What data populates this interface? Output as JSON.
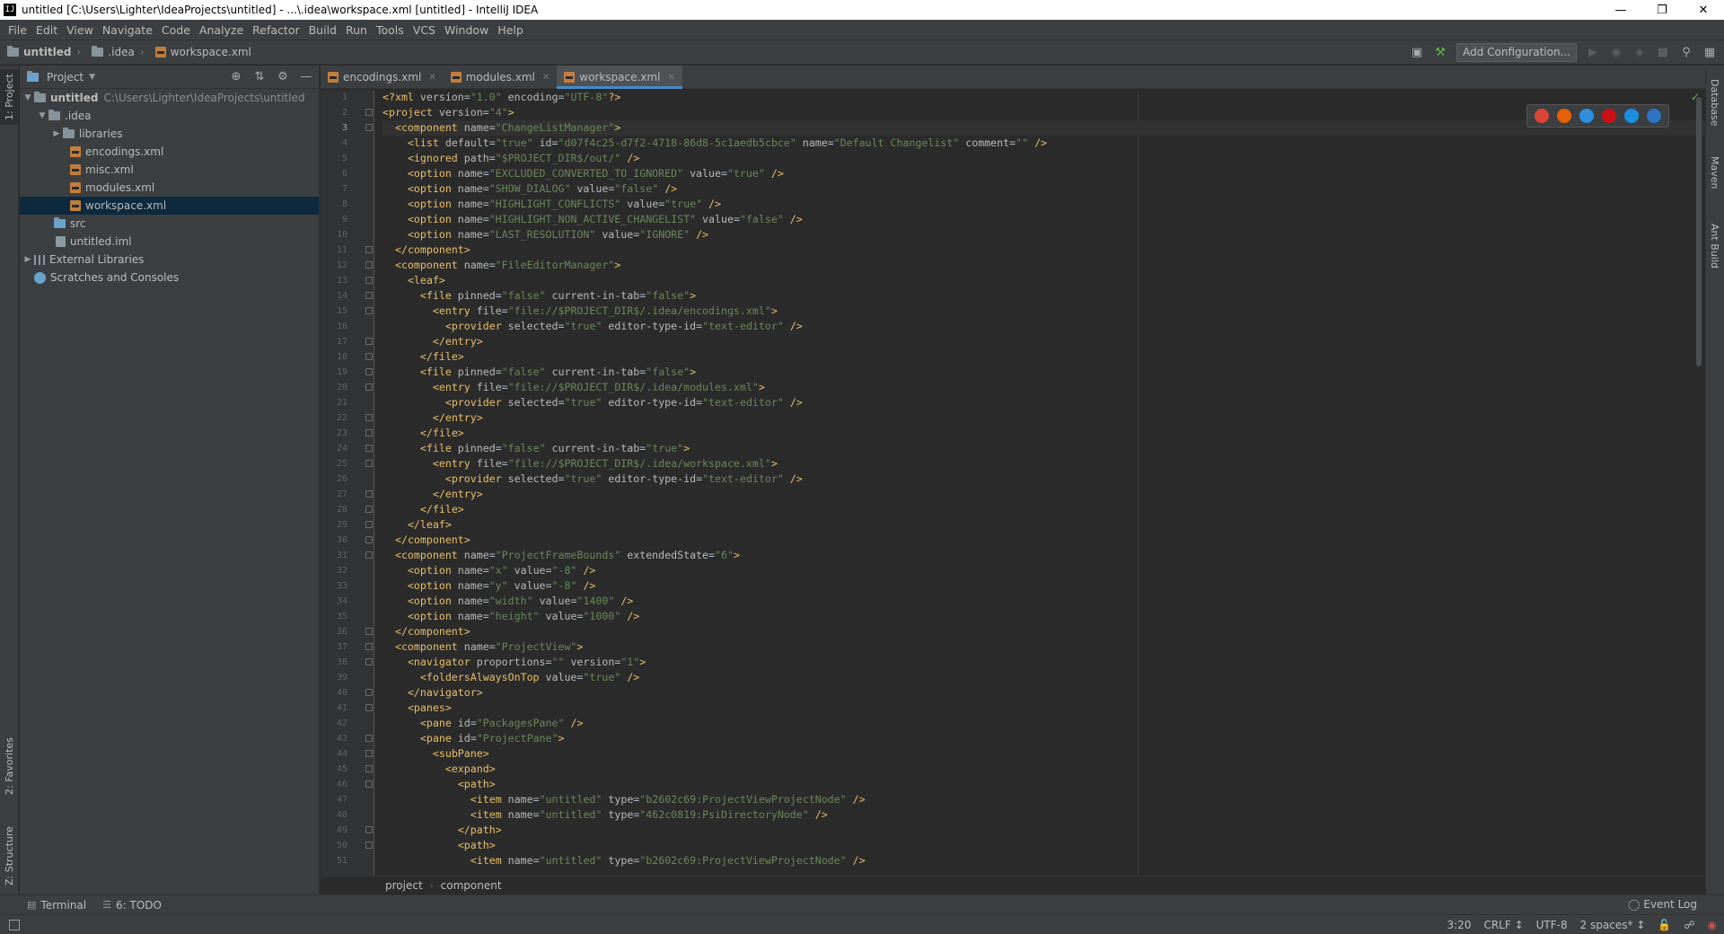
{
  "window": {
    "title": "untitled [C:\\Users\\Lighter\\IdeaProjects\\untitled] - ...\\.idea\\workspace.xml [untitled] - IntelliJ IDEA",
    "app_icon": "IJ"
  },
  "menu": [
    "File",
    "Edit",
    "View",
    "Navigate",
    "Code",
    "Analyze",
    "Refactor",
    "Build",
    "Run",
    "Tools",
    "VCS",
    "Window",
    "Help"
  ],
  "navbar": {
    "crumbs": [
      "untitled",
      ".idea",
      "workspace.xml"
    ],
    "add_configuration": "Add Configuration..."
  },
  "left_stripe": {
    "project": "1: Project",
    "favorites": "2: Favorites",
    "structure": "Z: Structure"
  },
  "right_stripe": {
    "database": "Database",
    "maven": "Maven",
    "ant": "Ant Build"
  },
  "project_panel": {
    "title": "Project",
    "root_name": "untitled",
    "root_path": "C:\\Users\\Lighter\\IdeaProjects\\untitled",
    "items": [
      ".idea",
      "libraries",
      "encodings.xml",
      "misc.xml",
      "modules.xml",
      "workspace.xml",
      "src",
      "untitled.iml",
      "External Libraries",
      "Scratches and Consoles"
    ]
  },
  "tabs": [
    "encodings.xml",
    "modules.xml",
    "workspace.xml"
  ],
  "editor": {
    "current_line": 3,
    "lines": [
      {
        "n": "1",
        "t": "<?xml version=\"1.0\" encoding=\"UTF-8\"?>"
      },
      {
        "n": "2",
        "t": "<project version=\"4\">"
      },
      {
        "n": "3",
        "t": "  <component name=\"ChangeListManager\">"
      },
      {
        "n": "4",
        "t": "    <list default=\"true\" id=\"d07f4c25-d7f2-4718-86d8-5c1aedb5cbce\" name=\"Default Changelist\" comment=\"\" />"
      },
      {
        "n": "5",
        "t": "    <ignored path=\"$PROJECT_DIR$/out/\" />"
      },
      {
        "n": "6",
        "t": "    <option name=\"EXCLUDED_CONVERTED_TO_IGNORED\" value=\"true\" />"
      },
      {
        "n": "7",
        "t": "    <option name=\"SHOW_DIALOG\" value=\"false\" />"
      },
      {
        "n": "8",
        "t": "    <option name=\"HIGHLIGHT_CONFLICTS\" value=\"true\" />"
      },
      {
        "n": "9",
        "t": "    <option name=\"HIGHLIGHT_NON_ACTIVE_CHANGELIST\" value=\"false\" />"
      },
      {
        "n": "10",
        "t": "    <option name=\"LAST_RESOLUTION\" value=\"IGNORE\" />"
      },
      {
        "n": "11",
        "t": "  </component>"
      },
      {
        "n": "12",
        "t": "  <component name=\"FileEditorManager\">"
      },
      {
        "n": "13",
        "t": "    <leaf>"
      },
      {
        "n": "14",
        "t": "      <file pinned=\"false\" current-in-tab=\"false\">"
      },
      {
        "n": "15",
        "t": "        <entry file=\"file://$PROJECT_DIR$/.idea/encodings.xml\">"
      },
      {
        "n": "16",
        "t": "          <provider selected=\"true\" editor-type-id=\"text-editor\" />"
      },
      {
        "n": "17",
        "t": "        </entry>"
      },
      {
        "n": "18",
        "t": "      </file>"
      },
      {
        "n": "19",
        "t": "      <file pinned=\"false\" current-in-tab=\"false\">"
      },
      {
        "n": "20",
        "t": "        <entry file=\"file://$PROJECT_DIR$/.idea/modules.xml\">"
      },
      {
        "n": "21",
        "t": "          <provider selected=\"true\" editor-type-id=\"text-editor\" />"
      },
      {
        "n": "22",
        "t": "        </entry>"
      },
      {
        "n": "23",
        "t": "      </file>"
      },
      {
        "n": "24",
        "t": "      <file pinned=\"false\" current-in-tab=\"true\">"
      },
      {
        "n": "25",
        "t": "        <entry file=\"file://$PROJECT_DIR$/.idea/workspace.xml\">"
      },
      {
        "n": "26",
        "t": "          <provider selected=\"true\" editor-type-id=\"text-editor\" />"
      },
      {
        "n": "27",
        "t": "        </entry>"
      },
      {
        "n": "28",
        "t": "      </file>"
      },
      {
        "n": "29",
        "t": "    </leaf>"
      },
      {
        "n": "30",
        "t": "  </component>"
      },
      {
        "n": "31",
        "t": "  <component name=\"ProjectFrameBounds\" extendedState=\"6\">"
      },
      {
        "n": "32",
        "t": "    <option name=\"x\" value=\"-8\" />"
      },
      {
        "n": "33",
        "t": "    <option name=\"y\" value=\"-8\" />"
      },
      {
        "n": "34",
        "t": "    <option name=\"width\" value=\"1400\" />"
      },
      {
        "n": "35",
        "t": "    <option name=\"height\" value=\"1000\" />"
      },
      {
        "n": "36",
        "t": "  </component>"
      },
      {
        "n": "37",
        "t": "  <component name=\"ProjectView\">"
      },
      {
        "n": "38",
        "t": "    <navigator proportions=\"\" version=\"1\">"
      },
      {
        "n": "39",
        "t": "      <foldersAlwaysOnTop value=\"true\" />"
      },
      {
        "n": "40",
        "t": "    </navigator>"
      },
      {
        "n": "41",
        "t": "    <panes>"
      },
      {
        "n": "42",
        "t": "      <pane id=\"PackagesPane\" />"
      },
      {
        "n": "43",
        "t": "      <pane id=\"ProjectPane\">"
      },
      {
        "n": "44",
        "t": "        <subPane>"
      },
      {
        "n": "45",
        "t": "          <expand>"
      },
      {
        "n": "46",
        "t": "            <path>"
      },
      {
        "n": "47",
        "t": "              <item name=\"untitled\" type=\"b2602c69:ProjectViewProjectNode\" />"
      },
      {
        "n": "48",
        "t": "              <item name=\"untitled\" type=\"462c0819:PsiDirectoryNode\" />"
      },
      {
        "n": "49",
        "t": "            </path>"
      },
      {
        "n": "50",
        "t": "            <path>"
      },
      {
        "n": "51",
        "t": "              <item name=\"untitled\" type=\"b2602c69:ProjectViewProjectNode\" />"
      }
    ]
  },
  "breadcrumb": [
    "project",
    "component"
  ],
  "tool_windows": {
    "terminal": "Terminal",
    "todo": "6: TODO",
    "event_log": "Event Log"
  },
  "status": {
    "position": "3:20",
    "line_sep": "CRLF ↕",
    "encoding": "UTF-8",
    "indent": "2 spaces* ↕"
  },
  "colors": {
    "accent": "#4a88c7",
    "tag": "#e8bf6a",
    "value": "#6a8759",
    "selection": "#0d293e"
  }
}
